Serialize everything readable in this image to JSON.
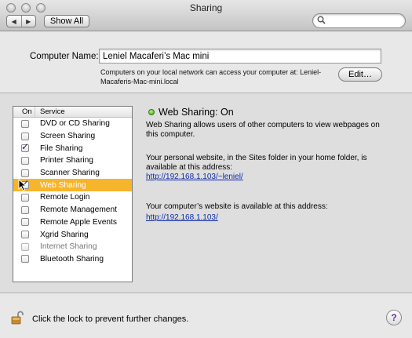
{
  "window": {
    "title": "Sharing"
  },
  "toolbar": {
    "back_icon": "◀",
    "forward_icon": "▶",
    "show_all_label": "Show All",
    "search_icon": "🔍",
    "search_placeholder": ""
  },
  "computer_name": {
    "label": "Computer Name:",
    "value": "Leniel Macaferi’s Mac mini",
    "info_line1": "Computers on your local network can access your computer at: Leniel-",
    "info_line2": "Macaferis-Mac-mini.local",
    "edit_label": "Edit…"
  },
  "services": {
    "header_on": "On",
    "header_service": "Service",
    "items": [
      {
        "label": "DVD or CD Sharing",
        "checked": false,
        "selected": false,
        "dim": false
      },
      {
        "label": "Screen Sharing",
        "checked": false,
        "selected": false,
        "dim": false
      },
      {
        "label": "File Sharing",
        "checked": true,
        "selected": false,
        "dim": false
      },
      {
        "label": "Printer Sharing",
        "checked": false,
        "selected": false,
        "dim": false
      },
      {
        "label": "Scanner Sharing",
        "checked": false,
        "selected": false,
        "dim": false
      },
      {
        "label": "Web Sharing",
        "checked": true,
        "selected": true,
        "dim": false
      },
      {
        "label": "Remote Login",
        "checked": false,
        "selected": false,
        "dim": false
      },
      {
        "label": "Remote Management",
        "checked": false,
        "selected": false,
        "dim": false
      },
      {
        "label": "Remote Apple Events",
        "checked": false,
        "selected": false,
        "dim": false
      },
      {
        "label": "Xgrid Sharing",
        "checked": false,
        "selected": false,
        "dim": false
      },
      {
        "label": "Internet Sharing",
        "checked": false,
        "selected": false,
        "dim": true
      },
      {
        "label": "Bluetooth Sharing",
        "checked": false,
        "selected": false,
        "dim": false
      }
    ]
  },
  "detail": {
    "status_title": "Web Sharing: On",
    "status_color": "#3ba616",
    "description": "Web Sharing allows users of other computers to view webpages on this computer.",
    "personal_text": "Your personal website, in the Sites folder in your home folder, is available at this address:",
    "personal_url": "http://192.168.1.103/~leniel/",
    "computer_text": "Your computer’s website is available at this address:",
    "computer_url": "http://192.168.1.103/"
  },
  "footer": {
    "lock_text": "Click the lock to prevent further changes.",
    "help_label": "?"
  },
  "colors": {
    "selection": "#f7b52d",
    "link": "#0c2aa8"
  }
}
